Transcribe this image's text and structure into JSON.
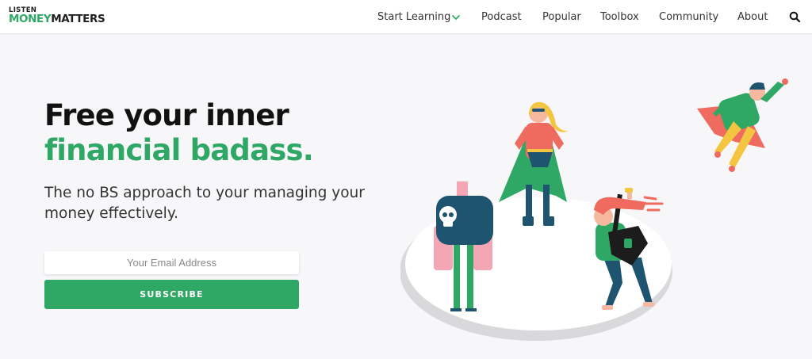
{
  "header": {
    "logo": {
      "top": "LISTEN",
      "money": "MONEY",
      "matters": "MATTERS"
    },
    "nav": [
      {
        "label": "Start Learning",
        "dropdown": true
      },
      {
        "label": "Podcast"
      },
      {
        "label": "Popular"
      },
      {
        "label": "Toolbox"
      },
      {
        "label": "Community"
      },
      {
        "label": "About"
      }
    ],
    "search_icon": "search-icon"
  },
  "hero": {
    "headline_line1": "Free your inner",
    "headline_line2": "financial badass.",
    "subheadline": "The no BS approach to your managing your money effectively.",
    "email_placeholder": "Your Email Address",
    "subscribe_label": "SUBSCRIBE"
  },
  "colors": {
    "brand_green": "#2fa765",
    "text_dark": "#111111",
    "background": "#f7f7f9"
  },
  "illustration": {
    "characters": [
      "skull-robot",
      "superheroine",
      "rock-guitarist",
      "flying-hero"
    ]
  }
}
